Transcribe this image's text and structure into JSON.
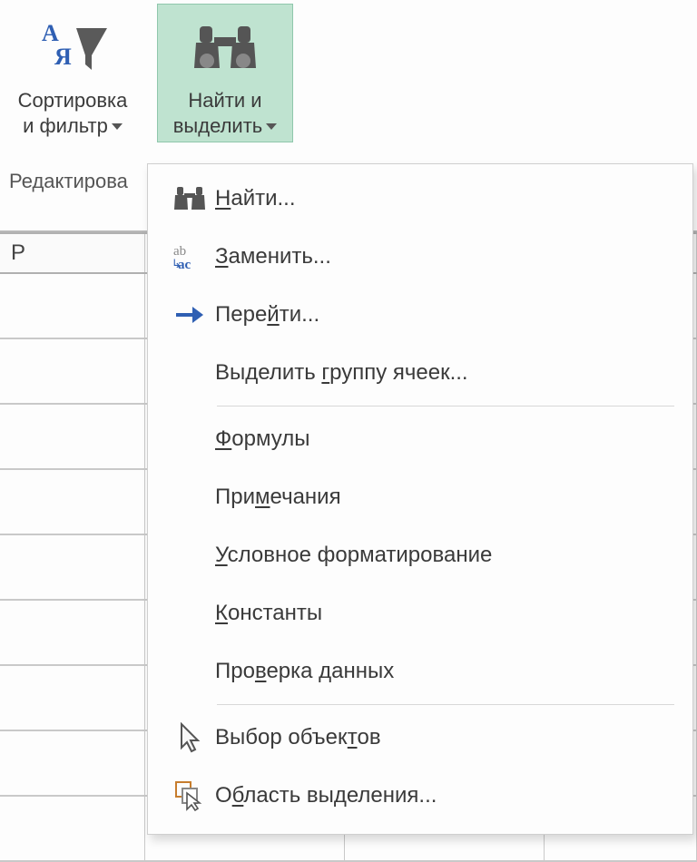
{
  "ribbon": {
    "sort_filter": {
      "line1": "Сортировка",
      "line2": "и фильтр"
    },
    "find_select": {
      "line1": "Найти и",
      "line2": "выделить"
    },
    "group_caption": "Редактирова"
  },
  "sheet": {
    "col_P": "P"
  },
  "menu": {
    "items": [
      {
        "label": "<u>Н</u>айти...",
        "icon": "binoculars"
      },
      {
        "label": "<u>З</u>аменить...",
        "icon": "replace"
      },
      {
        "label": "Пере<u>й</u>ти...",
        "icon": "arrow-right"
      },
      {
        "label": "Выделить <u>г</u>руппу ячеек...",
        "icon": ""
      },
      {
        "sep": true
      },
      {
        "label": "<u>Ф</u>ормулы",
        "icon": ""
      },
      {
        "label": "При<u>м</u>ечания",
        "icon": ""
      },
      {
        "label": "<u>У</u>словное форматирование",
        "icon": ""
      },
      {
        "label": "<u>К</u>онстанты",
        "icon": ""
      },
      {
        "label": "Про<u>в</u>ерка данных",
        "icon": ""
      },
      {
        "sep": true
      },
      {
        "label": "Выбор объек<u>т</u>ов",
        "icon": "cursor"
      },
      {
        "label": "О<u>б</u>ласть выделения...",
        "icon": "selection-pane"
      }
    ]
  }
}
